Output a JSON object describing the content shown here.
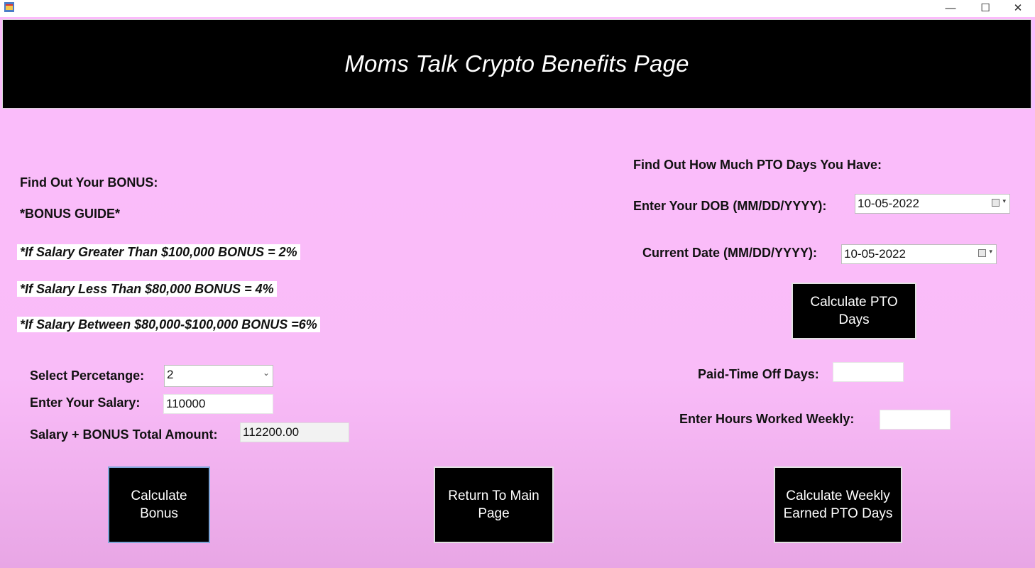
{
  "window": {
    "minimize_glyph": "—",
    "maximize_glyph": "☐",
    "close_glyph": "✕"
  },
  "header": {
    "title": "Moms Talk Crypto Benefits Page"
  },
  "bonus": {
    "heading": "Find Out Your BONUS:",
    "guide_heading": "*BONUS GUIDE*",
    "rules": [
      "*If Salary Greater Than $100,000 BONUS = 2%",
      "*If Salary Less Than $80,000 BONUS = 4%",
      "*If Salary Between $80,000-$100,000 BONUS =6%"
    ],
    "percentage_label": "Select Percetange:",
    "percentage_value": "2",
    "salary_label": "Enter Your Salary:",
    "salary_value": "110000",
    "total_label": "Salary + BONUS Total Amount:",
    "total_value": "112200.00"
  },
  "pto": {
    "heading": "Find Out How Much PTO Days You Have:",
    "dob_label": "Enter Your DOB (MM/DD/YYYY):",
    "dob_value": "10-05-2022",
    "current_label": "Current Date (MM/DD/YYYY):",
    "current_value": "10-05-2022",
    "calc_button": "Calculate PTO Days",
    "days_label": "Paid-Time Off Days:",
    "days_value": "",
    "hours_label": "Enter Hours Worked Weekly:",
    "hours_value": ""
  },
  "buttons": {
    "calc_bonus": "Calculate Bonus",
    "return_main": "Return To Main Page",
    "calc_weekly": "Calculate Weekly Earned PTO Days"
  },
  "colors": {
    "background": "#fbbcfb",
    "header_bg": "#000000",
    "button_bg": "#000000",
    "focus_border": "#7fa6d9"
  }
}
